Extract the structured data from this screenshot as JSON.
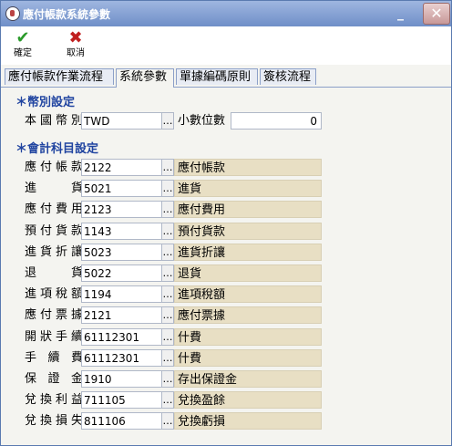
{
  "window": {
    "title": "應付帳款系統參數"
  },
  "toolbar": {
    "ok_label": "確定",
    "cancel_label": "取消"
  },
  "tabs": [
    {
      "label": "應付帳款作業流程"
    },
    {
      "label": "系統參數"
    },
    {
      "label": "單據編碼原則"
    },
    {
      "label": "簽核流程"
    }
  ],
  "currency_section": {
    "title": "幣別設定",
    "local_currency_label": "本國幣別",
    "local_currency_value": "TWD",
    "decimal_label": "小數位數",
    "decimal_value": "0"
  },
  "accounts_section": {
    "title": "會計科目設定",
    "rows": [
      {
        "label": "應付帳款",
        "code": "2122",
        "desc": "應付帳款"
      },
      {
        "label": "進貨",
        "code": "5021",
        "desc": "進貨"
      },
      {
        "label": "應付費用",
        "code": "2123",
        "desc": "應付費用"
      },
      {
        "label": "預付貨款",
        "code": "1143",
        "desc": "預付貨款"
      },
      {
        "label": "進貨折讓",
        "code": "5023",
        "desc": "進貨折讓"
      },
      {
        "label": "退貨",
        "code": "5022",
        "desc": "退貨"
      },
      {
        "label": "進項稅額",
        "code": "1194",
        "desc": "進項稅額"
      },
      {
        "label": "應付票據",
        "code": "2121",
        "desc": "應付票據"
      },
      {
        "label": "開狀手續",
        "code": "61112301",
        "desc": "什費"
      },
      {
        "label": "手續費",
        "code": "61112301",
        "desc": "什費"
      },
      {
        "label": "保證金",
        "code": "1910",
        "desc": "存出保證金"
      },
      {
        "label": "兌換利益",
        "code": "711105",
        "desc": "兌換盈餘"
      },
      {
        "label": "兌換損失",
        "code": "811106",
        "desc": "兌換虧損"
      }
    ]
  }
}
